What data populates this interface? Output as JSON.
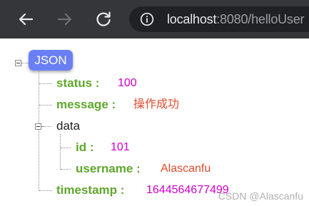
{
  "browser": {
    "address_host": "localhost",
    "address_path": ":8080/helloUser",
    "accent_toolbar_color": "#35363a"
  },
  "json_tree": {
    "root_label": "JSON",
    "status_key": "status :",
    "status_value": "100",
    "message_key": "message :",
    "message_value": "操作成功",
    "data_key": "data",
    "id_key": "id :",
    "id_value": "101",
    "username_key": "username :",
    "username_value": "Alascanfu",
    "timestamp_key": "timestamp :",
    "timestamp_value": "1644564677499",
    "colors": {
      "key": "#5fa72d",
      "number": "#cc00cc",
      "string": "#e04b2e",
      "badge": "#6b7ff5"
    }
  },
  "watermark": "CSDN @Alascanfu"
}
